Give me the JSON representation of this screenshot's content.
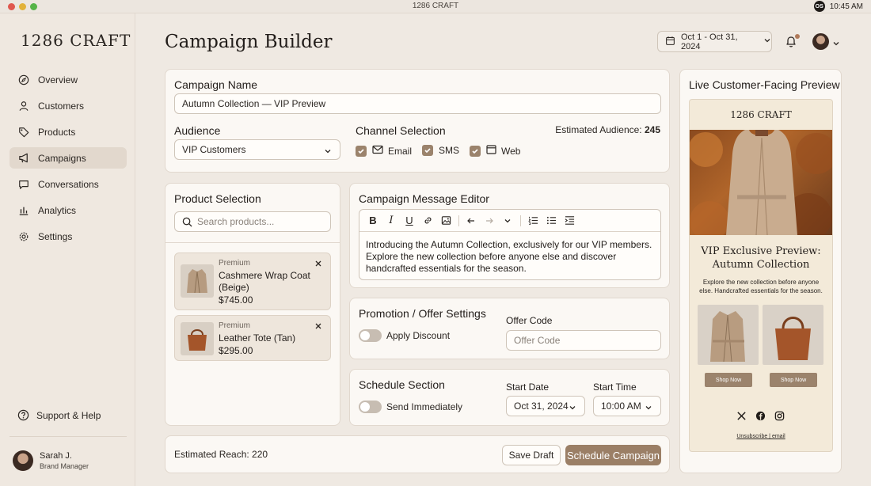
{
  "os": {
    "title": "1286 CRAFT",
    "badge": "OS",
    "time": "10:45 AM"
  },
  "brand": "1286 CRAFT",
  "sidebar": {
    "items": [
      {
        "label": "Overview",
        "icon": "compass-icon"
      },
      {
        "label": "Customers",
        "icon": "user-icon"
      },
      {
        "label": "Products",
        "icon": "tag-icon"
      },
      {
        "label": "Campaigns",
        "icon": "megaphone-icon",
        "active": true
      },
      {
        "label": "Conversations",
        "icon": "chat-icon"
      },
      {
        "label": "Analytics",
        "icon": "bar-chart-icon"
      },
      {
        "label": "Settings",
        "icon": "gear-icon"
      }
    ],
    "support": "Support & Help",
    "user": {
      "name": "Sarah J.",
      "role": "Brand Manager"
    }
  },
  "header": {
    "title": "Campaign Builder",
    "date_range": "Oct 1 - Oct 31, 2024"
  },
  "campaign": {
    "name_label": "Campaign Name",
    "name_value": "Autumn Collection — VIP Preview",
    "audience_label": "Audience",
    "audience_value": "VIP Customers",
    "channel_label": "Channel Selection",
    "estimated_label": "Estimated Audience:",
    "estimated_value": "245",
    "channels": [
      {
        "label": "Email",
        "checked": true,
        "icon": "mail-icon"
      },
      {
        "label": "SMS",
        "checked": true,
        "icon": "sms-icon"
      },
      {
        "label": "Web",
        "checked": true,
        "icon": "browser-icon"
      }
    ]
  },
  "products": {
    "title": "Product Selection",
    "search_placeholder": "Search products...",
    "items": [
      {
        "tag": "Premium",
        "name": "Cashmere Wrap Coat (Beige)",
        "price": "$745.00"
      },
      {
        "tag": "Premium",
        "name": "Leather Tote (Tan)",
        "price": "$295.00"
      }
    ]
  },
  "editor": {
    "title": "Campaign Message Editor",
    "body": "Introducing the Autumn Collection, exclusively for our VIP members. Explore the new collection before anyone else and discover handcrafted essentials for the season.",
    "toolbar": [
      "bold",
      "italic",
      "underline",
      "link",
      "image",
      "undo",
      "redo",
      "ordered-list",
      "bullet-list",
      "indent"
    ]
  },
  "promotion": {
    "title": "Promotion / Offer Settings",
    "toggle_label": "Apply Discount",
    "toggle_on": false,
    "offer_label": "Offer Code",
    "offer_placeholder": "Offer Code"
  },
  "schedule": {
    "title": "Schedule Section",
    "toggle_label": "Send Immediately",
    "toggle_on": false,
    "start_date_label": "Start Date",
    "start_date_value": "Oct 31, 2024",
    "start_time_label": "Start Time",
    "start_time_value": "10:00 AM"
  },
  "footer": {
    "reach": "Estimated Reach: 220",
    "save_draft": "Save Draft",
    "schedule": "Schedule Campaign"
  },
  "preview": {
    "title": "Live Customer-Facing Preview",
    "brand": "1286 CRAFT",
    "headline": "VIP Exclusive Preview: Autumn Collection",
    "sub": "Explore the new collection before anyone else. Handcrafted essentials for the season.",
    "shop_now": "Shop Now",
    "unsubscribe": "Unsubscribe | email",
    "social": [
      "x-icon",
      "facebook-icon",
      "instagram-icon"
    ]
  },
  "colors": {
    "accent": "#9b7f66",
    "background": "#efe9e2",
    "card": "#fbf8f4"
  }
}
